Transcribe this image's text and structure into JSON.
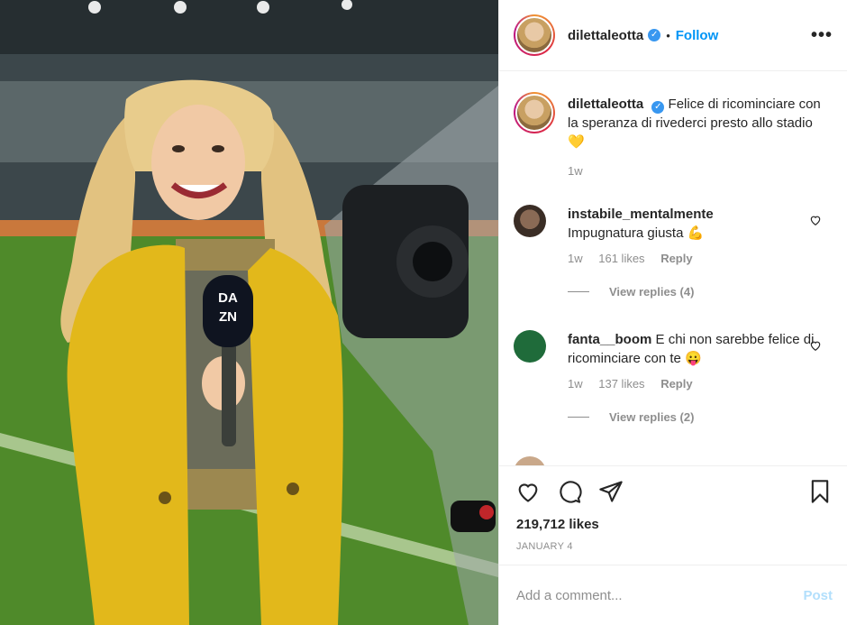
{
  "post": {
    "username": "dilettaleotta",
    "follow_label": "Follow",
    "dot": "•",
    "more_label": "•••"
  },
  "caption": {
    "username": "dilettaleotta",
    "text": "Felice di ricominciare con la speranza di rivederci presto allo stadio 💛",
    "time": "1w"
  },
  "comments": [
    {
      "username": "instabile_mentalmente",
      "text": "Impugnatura giusta 💪",
      "time": "1w",
      "likes": "161 likes",
      "reply_label": "Reply",
      "view_replies": "View replies (4)"
    },
    {
      "username": "fanta__boom",
      "text": "E chi non sarebbe felice di ricominciare con te 😛",
      "time": "1w",
      "likes": "137 likes",
      "reply_label": "Reply",
      "view_replies": "View replies (2)"
    }
  ],
  "actions": {
    "likes": "219,712 likes",
    "date": "JANUARY 4"
  },
  "add_comment": {
    "placeholder": "Add a comment...",
    "post_label": "Post"
  },
  "photo": {
    "mic_logo_top": "DA",
    "mic_logo_bottom": "ZN"
  },
  "colors": {
    "follow": "#0095f6",
    "post_disabled": "#b2dffc",
    "verified": "#3897f0"
  }
}
